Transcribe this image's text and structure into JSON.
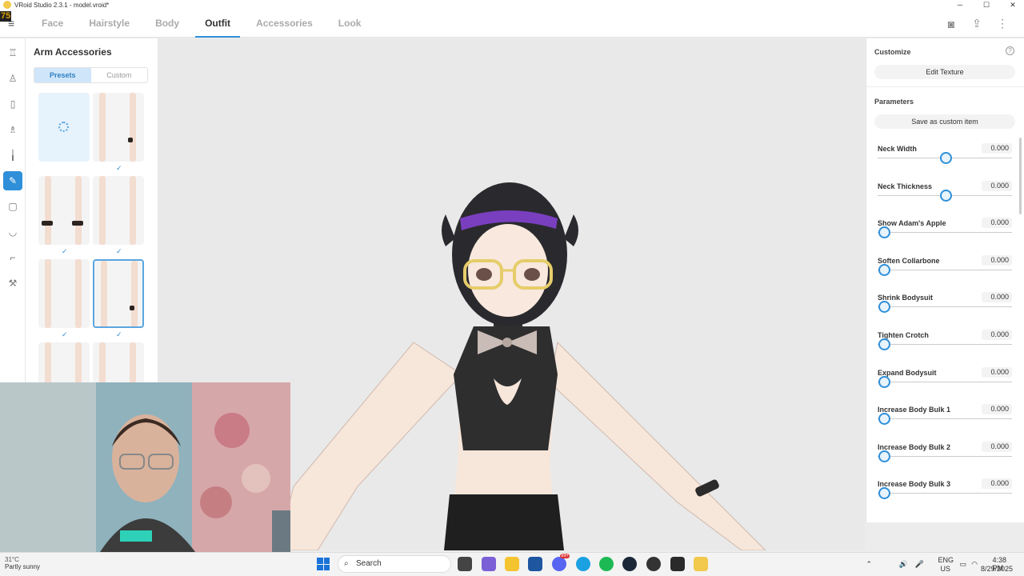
{
  "window": {
    "title": "VRoid Studio 2.3.1 - model.vroid*",
    "fps": "75",
    "minimize_glyph": "─",
    "maximize_glyph": "☐",
    "close_glyph": "✕"
  },
  "nav": {
    "tabs": [
      {
        "label": "Face"
      },
      {
        "label": "Hairstyle"
      },
      {
        "label": "Body"
      },
      {
        "label": "Outfit",
        "active": true
      },
      {
        "label": "Accessories"
      },
      {
        "label": "Look"
      }
    ],
    "icons": [
      "camera-icon",
      "share-icon",
      "more-vertical-icon"
    ]
  },
  "rail": {
    "items": [
      "top-icon",
      "shirt-icon",
      "pants-icon",
      "onepiece-icon",
      "glove-icon",
      "arm-accessory-icon",
      "legwear-icon",
      "underwear-icon",
      "shoes-icon",
      "wrench-icon"
    ],
    "active_index": 5
  },
  "left_panel": {
    "title": "Arm Accessories",
    "segment": {
      "presets": "Presets",
      "custom": "Custom",
      "active": "presets"
    },
    "selected_preset_index": 5
  },
  "right_panel": {
    "customize_title": "Customize",
    "edit_texture": "Edit Texture",
    "parameters_title": "Parameters",
    "save_custom": "Save as custom item",
    "params": [
      {
        "label": "Neck Width",
        "value": "0.000",
        "position": 0.5
      },
      {
        "label": "Neck Thickness",
        "value": "0.000",
        "position": 0.5
      },
      {
        "label": "Show Adam's Apple",
        "value": "0.000",
        "position": 0
      },
      {
        "label": "Soften Collarbone",
        "value": "0.000",
        "position": 0
      },
      {
        "label": "Shrink Bodysuit",
        "value": "0.000",
        "position": 0
      },
      {
        "label": "Tighten Crotch",
        "value": "0.000",
        "position": 0
      },
      {
        "label": "Expand Bodysuit",
        "value": "0.000",
        "position": 0
      },
      {
        "label": "Increase Body Bulk 1",
        "value": "0.000",
        "position": 0
      },
      {
        "label": "Increase Body Bulk 2",
        "value": "0.000",
        "position": 0
      },
      {
        "label": "Increase Body Bulk 3",
        "value": "0.000",
        "position": 0
      }
    ]
  },
  "taskbar": {
    "weather_temp": "31°C",
    "weather_text": "Partly sunny",
    "search_label": "Search",
    "lang_top": "ENG",
    "lang_bottom": "US",
    "time": "4:38 PM",
    "date": "8/29/2025",
    "badge": "99+"
  },
  "colors": {
    "accent": "#2f8fd8",
    "preset_active_bg": "#cfe6fa"
  }
}
